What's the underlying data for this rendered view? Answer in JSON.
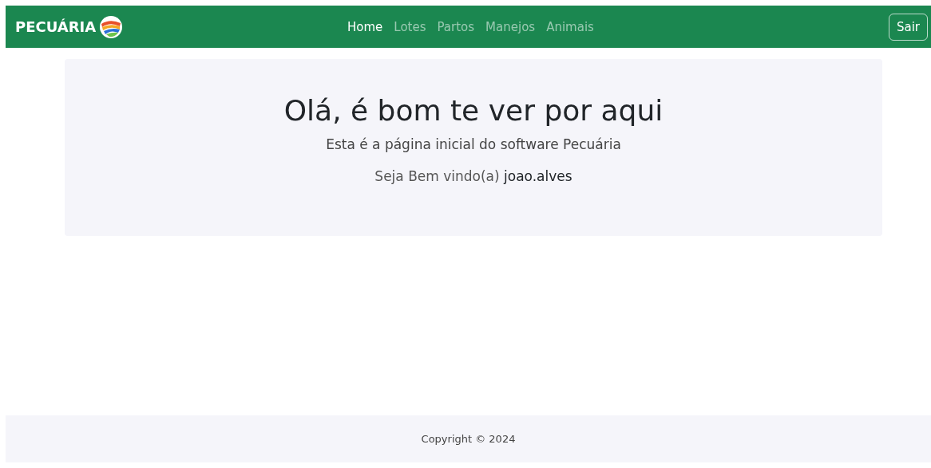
{
  "navbar": {
    "brand": "PECUÁRIA",
    "links": [
      {
        "label": "Home",
        "selected": true
      },
      {
        "label": "Lotes",
        "selected": false
      },
      {
        "label": "Partos",
        "selected": false
      },
      {
        "label": "Manejos",
        "selected": false
      },
      {
        "label": "Animais",
        "selected": false
      }
    ],
    "logout_button": "Sair"
  },
  "hero": {
    "title": "Olá, é bom te ver por aqui",
    "subtitle": "Esta é a página inicial do software Pecuária",
    "welcome": "Seja Bem vindo(a)",
    "username": "joao.alves"
  },
  "footer": {
    "copyright": "Copyright © 2024"
  }
}
